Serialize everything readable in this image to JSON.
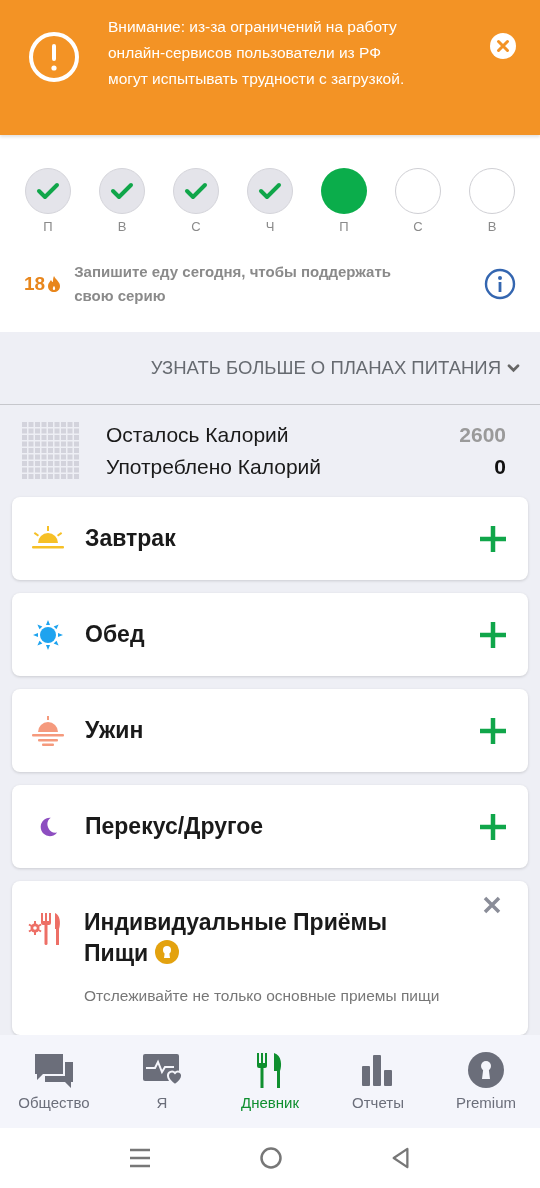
{
  "banner": {
    "text": "Внимание: из-за ограничений на работу онлайн-сервисов пользователи из РФ могут испытывать трудности с загрузкой."
  },
  "today": {
    "days": [
      {
        "label": "П",
        "kind": "done"
      },
      {
        "label": "В",
        "kind": "done"
      },
      {
        "label": "С",
        "kind": "done"
      },
      {
        "label": "Ч",
        "kind": "done"
      },
      {
        "label": "П",
        "kind": "current"
      },
      {
        "label": "С",
        "kind": "pending"
      },
      {
        "label": "В",
        "kind": "pending"
      }
    ],
    "streak": {
      "count": "18",
      "text": "Запишите еду сегодня, чтобы поддержать свою серию"
    }
  },
  "plans_link": "УЗНАТЬ БОЛЬШЕ О ПЛАНАХ ПИТАНИЯ",
  "calories": [
    {
      "label": "Осталось Калорий",
      "value": "2600",
      "kind": "remaining"
    },
    {
      "label": "Употреблено Калорий",
      "value": "0",
      "kind": "consumed"
    }
  ],
  "meals": [
    {
      "name": "Завтрак",
      "kind": "breakfast"
    },
    {
      "name": "Обед",
      "kind": "lunch"
    },
    {
      "name": "Ужин",
      "kind": "dinner"
    },
    {
      "name": "Перекус/Другое",
      "kind": "snack"
    }
  ],
  "custom_meals": {
    "title": "Индивидуальные Приёмы Пищи",
    "text": "Отслеживайте не только основные приемы пищи"
  },
  "nav": [
    {
      "label": "Общество",
      "kind": "community",
      "selected": false
    },
    {
      "label": "Я",
      "kind": "me",
      "selected": false
    },
    {
      "label": "Дневник",
      "kind": "diary",
      "selected": true
    },
    {
      "label": "Отчеты",
      "kind": "reports",
      "selected": false
    },
    {
      "label": "Premium",
      "kind": "premium",
      "selected": false
    }
  ]
}
